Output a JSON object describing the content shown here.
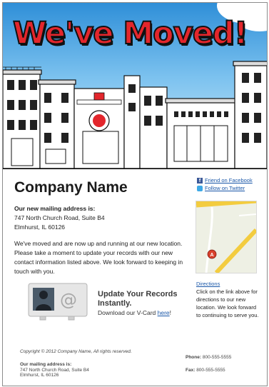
{
  "banner": {
    "title": "We've Moved!"
  },
  "main": {
    "company_name": "Company Name",
    "address_heading": "Our new mailing address is:",
    "address_line1": "747 North Church Road, Suite B4",
    "address_line2": "Elmhurst, IL 60126",
    "paragraph": "We've moved and are now up and running at our new location. Please take a moment to update your records with our new contact information listed above. We look forward to keeping in touch with you."
  },
  "social": {
    "facebook": "Friend on Facebook",
    "twitter": "Follow on Twitter"
  },
  "map": {
    "marker_label": "A"
  },
  "directions": {
    "link": "Directions",
    "text": "Click on the link above for directions to our new location. We look forward to continuing to serve you."
  },
  "vcard": {
    "title": "Update Your Records Instantly.",
    "download_prefix": "Download our V-Card ",
    "link": "here",
    "suffix": "!"
  },
  "footer": {
    "copyright": "Copyright © 2012 Company Name, All rights reserved.",
    "mail_heading": "Our mailing address is:",
    "mail_line1": "747 North Church Road, Suite B4",
    "mail_line2": "Elmhurst, IL 60126",
    "phone_label": "Phone:",
    "phone": "800-555-5555",
    "fax_label": "Fax:",
    "fax": "800-555-5555"
  },
  "colors": {
    "title_red": "#e3262c",
    "link_blue": "#1a57a8",
    "sky": "#7cc2ef"
  }
}
